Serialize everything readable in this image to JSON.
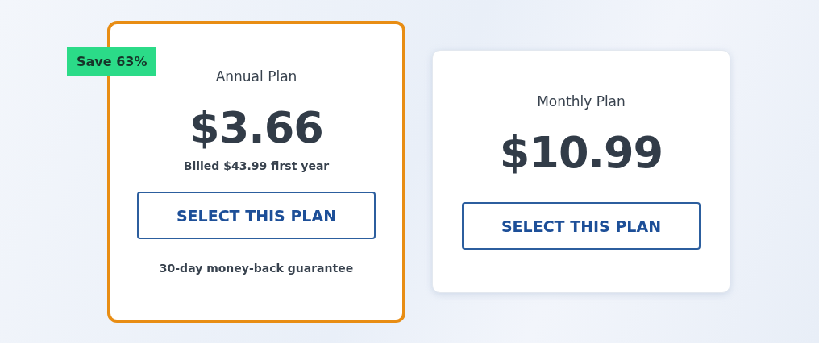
{
  "plans": [
    {
      "name": "Annual Plan",
      "price": "$3.66",
      "billing": "Billed $43.99 first year",
      "button": "SELECT THIS PLAN",
      "note": "30-day money-back guarantee",
      "badge": "Save 63%",
      "selected": true
    },
    {
      "name": "Monthly Plan",
      "price": "$10.99",
      "button": "SELECT THIS PLAN",
      "selected": false
    }
  ]
}
